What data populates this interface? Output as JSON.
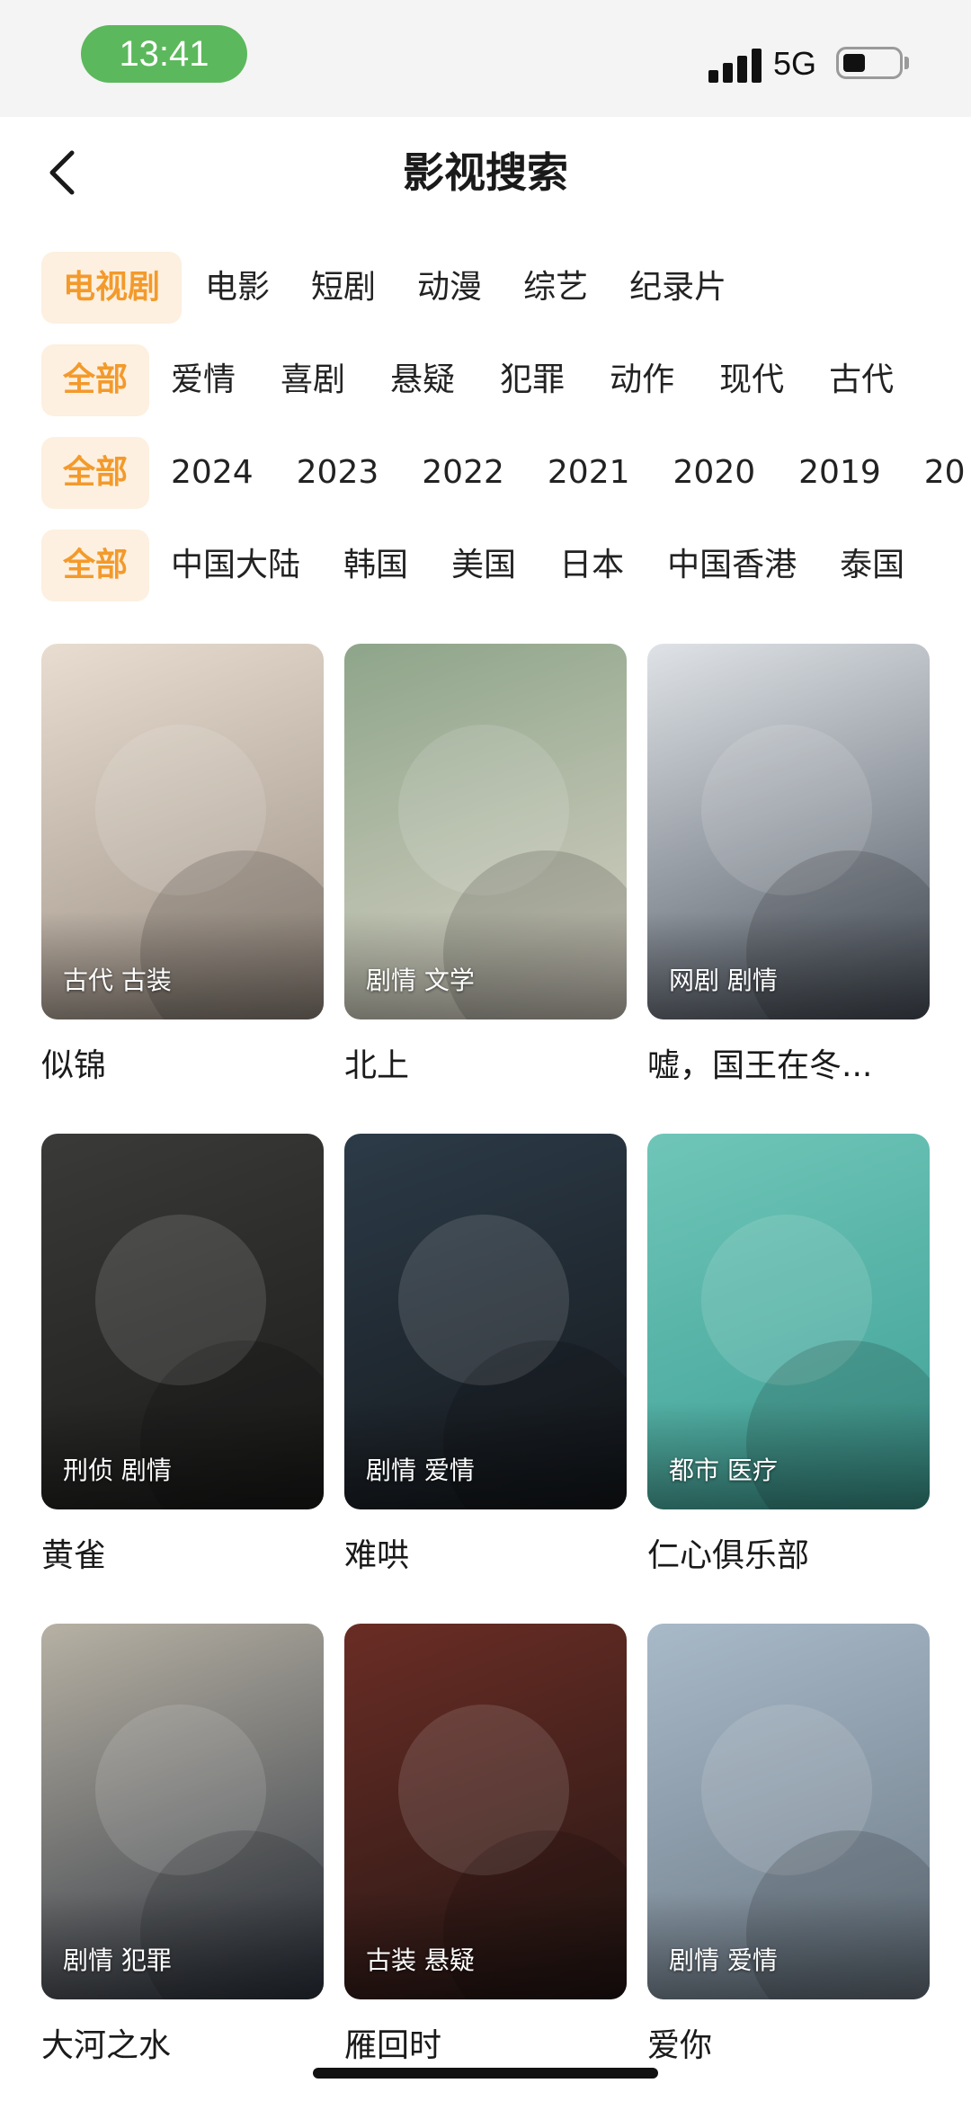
{
  "status_bar": {
    "time": "13:41",
    "network": "5G"
  },
  "header": {
    "title": "影视搜索"
  },
  "filters": {
    "types": [
      "电视剧",
      "电影",
      "短剧",
      "动漫",
      "综艺",
      "纪录片"
    ],
    "genres": [
      "全部",
      "爱情",
      "喜剧",
      "悬疑",
      "犯罪",
      "动作",
      "现代",
      "古代"
    ],
    "years": [
      "全部",
      "2024",
      "2023",
      "2022",
      "2021",
      "2020",
      "2019",
      "20"
    ],
    "regions": [
      "全部",
      "中国大陆",
      "韩国",
      "美国",
      "日本",
      "中国香港",
      "泰国"
    ]
  },
  "shows": [
    {
      "title": "似锦",
      "tags": "古代 古装",
      "colors": [
        "#e8ddd0",
        "#9b8f84"
      ]
    },
    {
      "title": "北上",
      "tags": "剧情 文学",
      "colors": [
        "#8ea58a",
        "#d9d2c6"
      ]
    },
    {
      "title": "嘘，国王在冬...",
      "tags": "网剧 剧情",
      "colors": [
        "#dfe3e7",
        "#4e5661"
      ]
    },
    {
      "title": "黄雀",
      "tags": "刑侦 剧情",
      "colors": [
        "#3a3a38",
        "#1b1b1a"
      ]
    },
    {
      "title": "难哄",
      "tags": "剧情 爱情",
      "colors": [
        "#2c3b48",
        "#15181c"
      ]
    },
    {
      "title": "仁心俱乐部",
      "tags": "都市 医疗",
      "colors": [
        "#6fc6b8",
        "#3e9f95"
      ]
    },
    {
      "title": "大河之水",
      "tags": "剧情 犯罪",
      "colors": [
        "#b7b1a4",
        "#2f3641"
      ]
    },
    {
      "title": "雁回时",
      "tags": "古装 悬疑",
      "colors": [
        "#6a2d25",
        "#241614"
      ]
    },
    {
      "title": "爱你",
      "tags": "剧情 爱情",
      "colors": [
        "#a8b9c8",
        "#6d7a86"
      ]
    }
  ]
}
